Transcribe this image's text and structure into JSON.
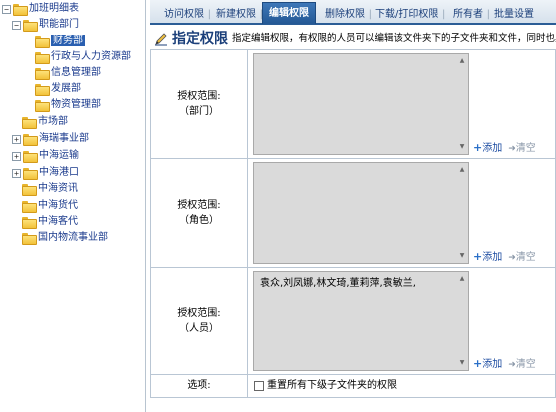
{
  "tree": {
    "items": [
      {
        "label": "加班明细表",
        "toggle": "⊟"
      },
      {
        "label": "职能部门",
        "toggle": "⊟"
      },
      {
        "label": "财务部",
        "selected": true
      },
      {
        "label": "行政与人力资源部"
      },
      {
        "label": "信息管理部"
      },
      {
        "label": "发展部"
      },
      {
        "label": "物资管理部"
      },
      {
        "label": "市场部"
      },
      {
        "label": "海瑞事业部",
        "toggle": "⊞"
      },
      {
        "label": "中海运输",
        "toggle": "⊞"
      },
      {
        "label": "中海港口",
        "toggle": "⊞"
      },
      {
        "label": "中海资讯"
      },
      {
        "label": "中海货代"
      },
      {
        "label": "中海客代"
      },
      {
        "label": "国内物流事业部"
      }
    ]
  },
  "tabs": [
    {
      "label": "访问权限"
    },
    {
      "label": "新建权限"
    },
    {
      "label": "编辑权限",
      "active": true
    },
    {
      "label": "删除权限"
    },
    {
      "label": "下载/打印权限"
    },
    {
      "label": "所有者"
    },
    {
      "label": "批量设置"
    }
  ],
  "header": {
    "title": "指定权限",
    "description": "指定编辑权限，有权限的人员可以编辑该文件夹下的子文件夹和文件，同时也具有Off"
  },
  "rows": [
    {
      "label_line1": "授权范围:",
      "label_line2": "（部门）",
      "value": "",
      "add_label": "添加",
      "clear_label": "清空"
    },
    {
      "label_line1": "授权范围:",
      "label_line2": "（角色）",
      "value": "",
      "add_label": "添加",
      "clear_label": "清空"
    },
    {
      "label_line1": "授权范围:",
      "label_line2": "（人员）",
      "value": "袁众,刘凤娜,林文琦,董莉萍,袁敏兰,",
      "add_label": "添加",
      "clear_label": "清空"
    }
  ],
  "options": {
    "label": "选项:",
    "checkbox_label": "重置所有下级子文件夹的权限",
    "checked": false
  },
  "colors": {
    "accent": "#2b5d96",
    "tab_active": "#245894",
    "textarea_bg": "#dadada",
    "link": "#1a4aa0"
  }
}
